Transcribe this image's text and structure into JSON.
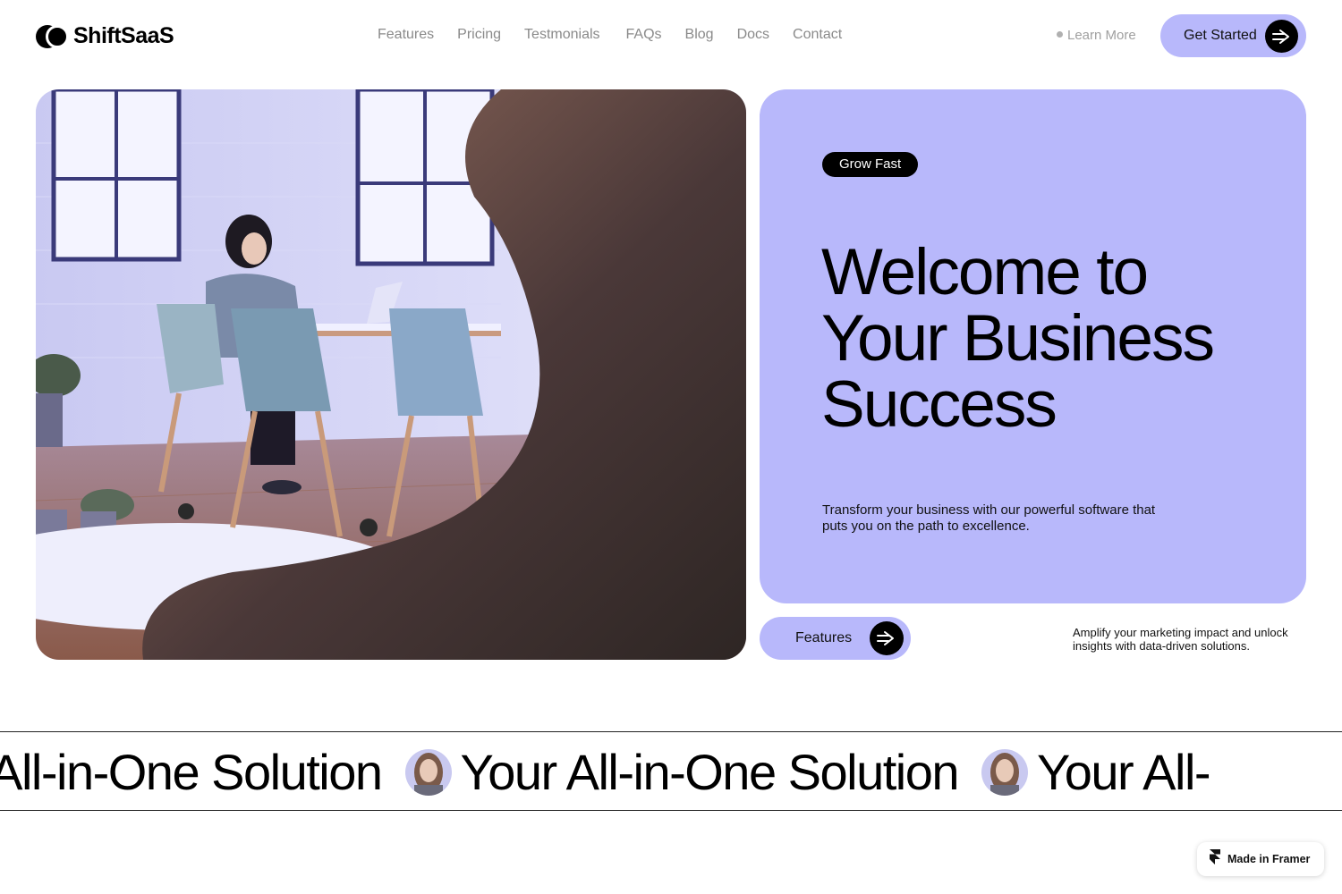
{
  "brand": {
    "name": "ShiftSaaS"
  },
  "nav": {
    "links": [
      "Features",
      "Pricing",
      "Testmonials",
      "FAQs",
      "Blog",
      "Docs",
      "Contact"
    ],
    "learn_more": "Learn More",
    "cta": "Get Started"
  },
  "hero": {
    "tag": "Grow Fast",
    "title_lines": [
      "Welcome to",
      "Your Business",
      "Success"
    ],
    "description": "Transform your business with our powerful software that puts you on the path to excellence.",
    "features_button": "Features",
    "amplify_text": "Amplify your marketing impact and unlock insights with data-driven solutions."
  },
  "marquee": {
    "text": "Your All-in-One Solution",
    "partial_left": "r All-in-One Solution",
    "partial_right": "Your All-"
  },
  "badge": {
    "label": "Made in Framer"
  },
  "colors": {
    "accent": "#b8b8fb",
    "black": "#000000",
    "muted_text": "#8a8a8a"
  },
  "icons": {
    "cta": "arrow-right-icon",
    "badge": "framer-logo-icon"
  }
}
